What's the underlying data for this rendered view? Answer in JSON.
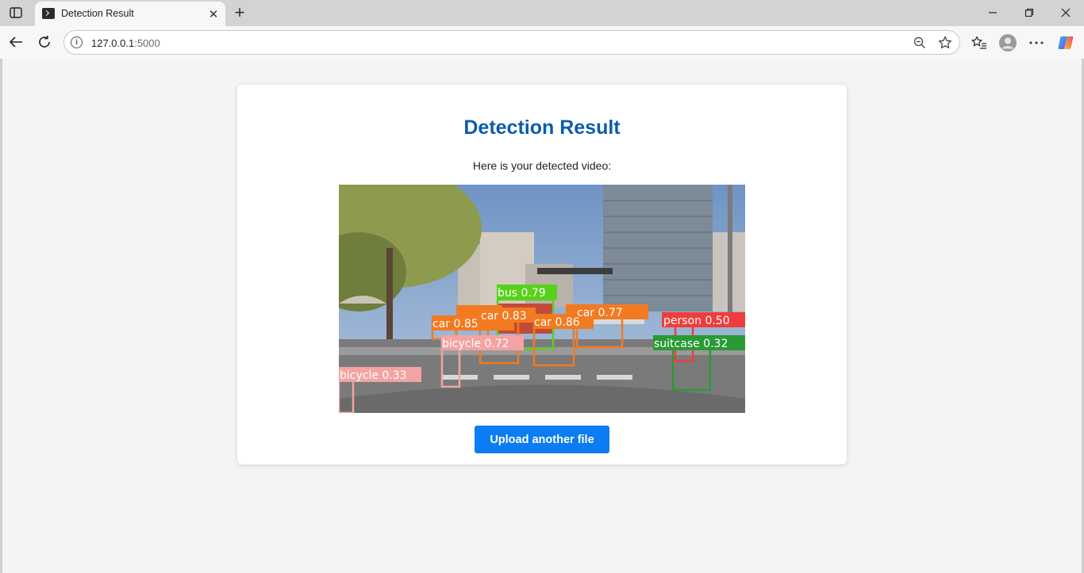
{
  "browser": {
    "tab_title": "Detection Result",
    "url_host": "127.0.0.1",
    "url_port": ":5000"
  },
  "page": {
    "title": "Detection Result",
    "subtitle": "Here is your detected video:",
    "upload_button": "Upload another file"
  },
  "detections": [
    {
      "label": "bus 0.79",
      "color": "#57d21a"
    },
    {
      "label": "car 0.83",
      "color": "#f27a20"
    },
    {
      "label": "car 0.86",
      "color": "#f27a20"
    },
    {
      "label": "car 0.77",
      "color": "#f27a20"
    },
    {
      "label": "car 0.85",
      "color": "#f27a20"
    },
    {
      "label": "bicycle 0.72",
      "color": "#f4a3a3"
    },
    {
      "label": "bicycle 0.33",
      "color": "#f4a3a3"
    },
    {
      "label": "person 0.50",
      "color": "#f03c3c"
    },
    {
      "label": "suitcase 0.32",
      "color": "#2a9a36"
    }
  ]
}
